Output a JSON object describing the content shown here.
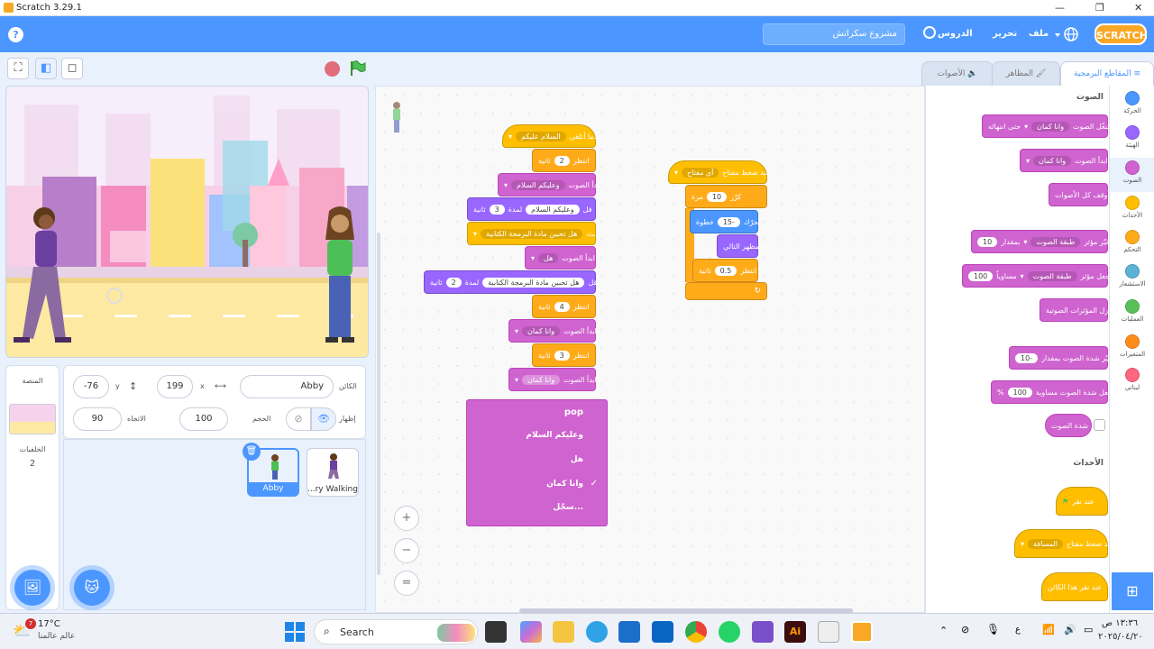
{
  "window": {
    "title": "Scratch 3.29.1",
    "controls": [
      "—",
      "❐",
      "✕"
    ]
  },
  "menubar": {
    "logo": "SCRATCH",
    "globe_icon": "globe-icon",
    "file": "ملف",
    "edit": "تحرير",
    "tutorials": "الدروس",
    "project_title": "مشروع سكراتش",
    "help": "?"
  },
  "tabs": {
    "code": "المقاطع البرمجية",
    "costumes": "المظاهر",
    "sounds": "الأصوات"
  },
  "sprite_info": {
    "sprite_label": "الكائن",
    "sprite_name": "Abby",
    "x_label": "x",
    "x_value": "199",
    "y_label": "y",
    "y_value": "-76",
    "show_label": "إظهار",
    "size_label": "الحجم",
    "size_value": "100",
    "direction_label": "الاتجاه",
    "direction_value": "90"
  },
  "sprites": [
    {
      "name": "Abby",
      "selected": true
    },
    {
      "name": "...ry Walking",
      "selected": false
    }
  ],
  "stage_panel": {
    "title": "المنصة",
    "backdrops_label": "الخلفيات",
    "backdrops_count": "2"
  },
  "script1": {
    "hat": "عندما أتلقى",
    "hat_msg": "السلام عليكم",
    "wait1": "انتظر",
    "wait1_val": "2",
    "sec": "ثانية",
    "start_sound1": "ابدأ الصوت",
    "sound1": "وعليكم السلام",
    "say": "قل",
    "say1_text": "وعليكم السلام",
    "for": "لمدة",
    "say1_secs": "3",
    "broadcast": "بث",
    "broadcast_msg": "هل تحبين مادة البرمجة الكتابية",
    "start_sound2": "ابدأ الصوت",
    "sound2": "هل",
    "say2_text": "هل تحبين مادة البرمجة الكتابية",
    "say2_secs": "2",
    "wait2_val": "4",
    "start_sound3": "ابدأ الصوت",
    "sound3": "وانا كمان",
    "wait3_val": "3",
    "start_sound4": "ابدأ الصوت",
    "sound4": "وانا كمان"
  },
  "script2": {
    "hat": "عند ضغط مفتاح",
    "key": "أي مفتاح",
    "repeat": "كرّر",
    "repeat_val": "10",
    "times": "مرة",
    "move": "تحرّك",
    "move_val": "-15",
    "steps": "خطوة",
    "next_costume": "المظهر التالي",
    "wait": "انتظر",
    "wait_val": "0.5",
    "sec": "ثانية"
  },
  "dropdown": {
    "items": [
      "pop",
      "وعليكم السلام",
      "هل",
      "وانا كمان",
      "سجّل..."
    ],
    "checked_index": 3,
    "check_icon": "✓"
  },
  "palette": {
    "sound_title": "الصوت",
    "play_until_done": "شغّل الصوت",
    "play_until_done_sound": "وانا كمان",
    "until_done": "حتى انتهائه",
    "start_sound": "ابدأ الصوت",
    "start_sound_val": "وانا كمان",
    "stop_all": "أوقف كل الأصوات",
    "change_effect": "غيّر مؤثر",
    "effect_name": "طبقة الصوت",
    "by": "بمقدار",
    "change_effect_val": "10",
    "set_effect": "اجعل مؤثر",
    "set_effect_name": "طبقة الصوت",
    "equal": "مساوياً",
    "set_effect_val": "100",
    "clear_effects": "أزل المؤثرات الصوتية",
    "change_volume": "غيّر شدة الصوت بمقدار",
    "change_volume_val": "-10",
    "set_volume": "اجعل شدة الصوت مساوية",
    "set_volume_val": "100",
    "percent": "%",
    "volume": "شدة الصوت",
    "events_title": "الأحداث",
    "when_flag": "عند نقر",
    "when_key": "عند ضغط مفتاح",
    "when_key_val": "المسافة",
    "when_clicked": "عند نقر هذا الكائن"
  },
  "categories": [
    {
      "label": "الحركة",
      "color": "#4c97ff"
    },
    {
      "label": "الهيئة",
      "color": "#9966ff"
    },
    {
      "label": "الصوت",
      "color": "#cf63cf"
    },
    {
      "label": "الأحداث",
      "color": "#ffbf00"
    },
    {
      "label": "التحكم",
      "color": "#ffab19"
    },
    {
      "label": "الاستشعار",
      "color": "#5cb1d6"
    },
    {
      "label": "العمليات",
      "color": "#59c059"
    },
    {
      "label": "المتغيرات",
      "color": "#ff8c1a"
    },
    {
      "label": "لبناتي",
      "color": "#ff6680"
    }
  ],
  "taskbar": {
    "weather_temp": "17°C",
    "weather_text": "عالم عالمنا",
    "weather_badge": "7",
    "search": "Search",
    "time": "١٣:٣٦ ص",
    "date": "٢٠٢٥/٠٤/٢٠",
    "lang": "ع"
  }
}
